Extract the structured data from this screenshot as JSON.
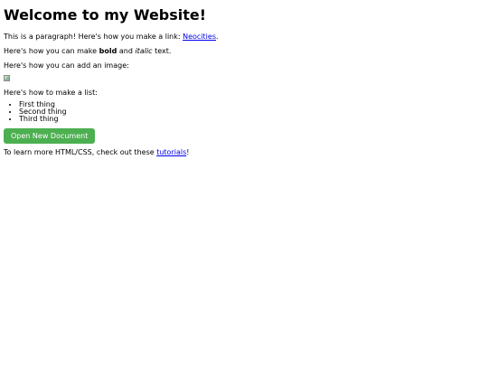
{
  "heading": "Welcome to my Website!",
  "paragraph1": {
    "before": "This is a paragraph! Here's how you make a link: ",
    "link": "Neocities",
    "after": "."
  },
  "paragraph2": {
    "before": "Here's how you can make ",
    "bold": "bold",
    "middle": " and ",
    "italic": "italic",
    "after": " text."
  },
  "paragraph3": "Here's how you can add an image:",
  "image": {
    "icon": "broken-image-icon"
  },
  "paragraph4": "Here's how to make a list:",
  "list": [
    "First thing",
    "Second thing",
    "Third thing"
  ],
  "button": {
    "label": "Open New Document",
    "color": "#4caf50"
  },
  "paragraph5": {
    "before": "To learn more HTML/CSS, check out these ",
    "link": "tutorials",
    "after": "!"
  },
  "colors": {
    "link": "#0000ee",
    "button": "#4caf50",
    "button_text": "#ffffff"
  }
}
